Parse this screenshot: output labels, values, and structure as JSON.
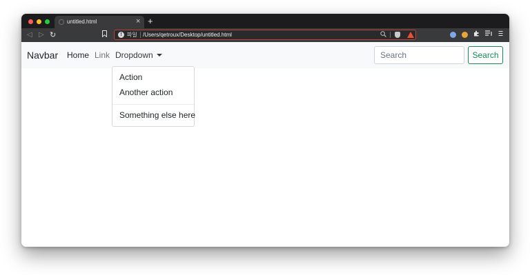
{
  "browser": {
    "tab": {
      "title": "untitled.html",
      "close_glyph": "×",
      "favicon": "globe-icon"
    },
    "new_tab_glyph": "+",
    "toolbar": {
      "back_icon": "back-arrow-icon",
      "forward_icon": "forward-arrow-icon",
      "reload_icon": "reload-icon",
      "bookmark_icon": "bookmark-icon"
    },
    "address_bar": {
      "scheme_label": "파일",
      "url": "/Users/qetroux/Desktop/untitled.html",
      "zoom_icon": "zoom-icon",
      "shield_icon": "brave-shields-icon",
      "rewards_icon": "brave-rewards-icon"
    },
    "extensions": [
      "vpn-icon",
      "wallet-icon",
      "puzzle-icon",
      "playlist-icon",
      "menu-icon"
    ]
  },
  "navbar": {
    "brand": "Navbar",
    "links": {
      "home": "Home",
      "link": "Link",
      "dropdown": "Dropdown"
    },
    "dropdown_menu": {
      "items": [
        "Action",
        "Another action",
        "Something else here"
      ]
    },
    "search": {
      "placeholder": "Search",
      "value": "",
      "button_label": "Search"
    }
  },
  "colors": {
    "navbar_bg": "#f8f9fa",
    "success": "#198754",
    "link_muted": "#6c757d",
    "omnibox_border": "#b8443a"
  }
}
